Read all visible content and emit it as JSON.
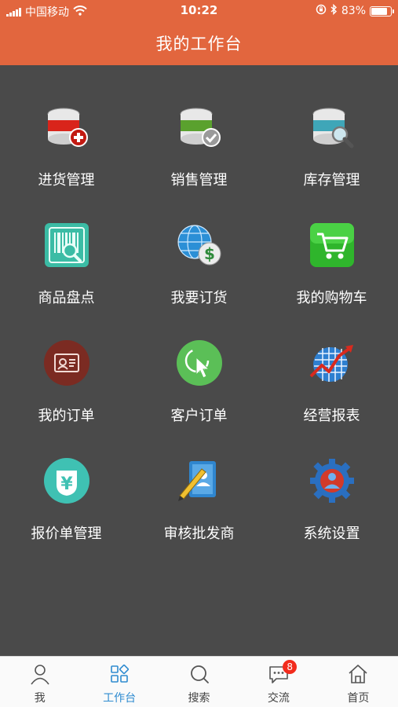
{
  "status_bar": {
    "carrier": "中国移动",
    "time": "10:22",
    "battery_percent": "83%",
    "battery_level": 0.83,
    "icons": [
      "signal-icon",
      "wifi-icon",
      "orientation-lock-icon",
      "bluetooth-icon",
      "battery-icon"
    ]
  },
  "header": {
    "title": "我的工作台"
  },
  "colors": {
    "header_bg": "#e2663e",
    "grid_bg": "#4a4a4a",
    "active_tab": "#2e8bd0",
    "badge": "#f22b1c"
  },
  "grid": {
    "items": [
      {
        "label": "进货管理",
        "icon": "database-add-icon"
      },
      {
        "label": "销售管理",
        "icon": "database-check-icon"
      },
      {
        "label": "库存管理",
        "icon": "database-search-icon"
      },
      {
        "label": "商品盘点",
        "icon": "barcode-scan-icon"
      },
      {
        "label": "我要订货",
        "icon": "globe-money-icon"
      },
      {
        "label": "我的购物车",
        "icon": "shopping-cart-icon"
      },
      {
        "label": "我的订单",
        "icon": "order-card-icon"
      },
      {
        "label": "客户订单",
        "icon": "pointer-click-icon"
      },
      {
        "label": "经营报表",
        "icon": "trend-chart-icon"
      },
      {
        "label": "报价单管理",
        "icon": "yen-quote-icon"
      },
      {
        "label": "审核批发商",
        "icon": "contact-book-icon"
      },
      {
        "label": "系统设置",
        "icon": "user-gear-icon"
      }
    ]
  },
  "tabbar": {
    "tabs": [
      {
        "label": "我",
        "icon": "person-icon"
      },
      {
        "label": "工作台",
        "icon": "apps-icon",
        "active": true
      },
      {
        "label": "搜索",
        "icon": "search-icon"
      },
      {
        "label": "交流",
        "icon": "chat-icon",
        "badge": "8"
      },
      {
        "label": "首页",
        "icon": "home-icon"
      }
    ]
  }
}
